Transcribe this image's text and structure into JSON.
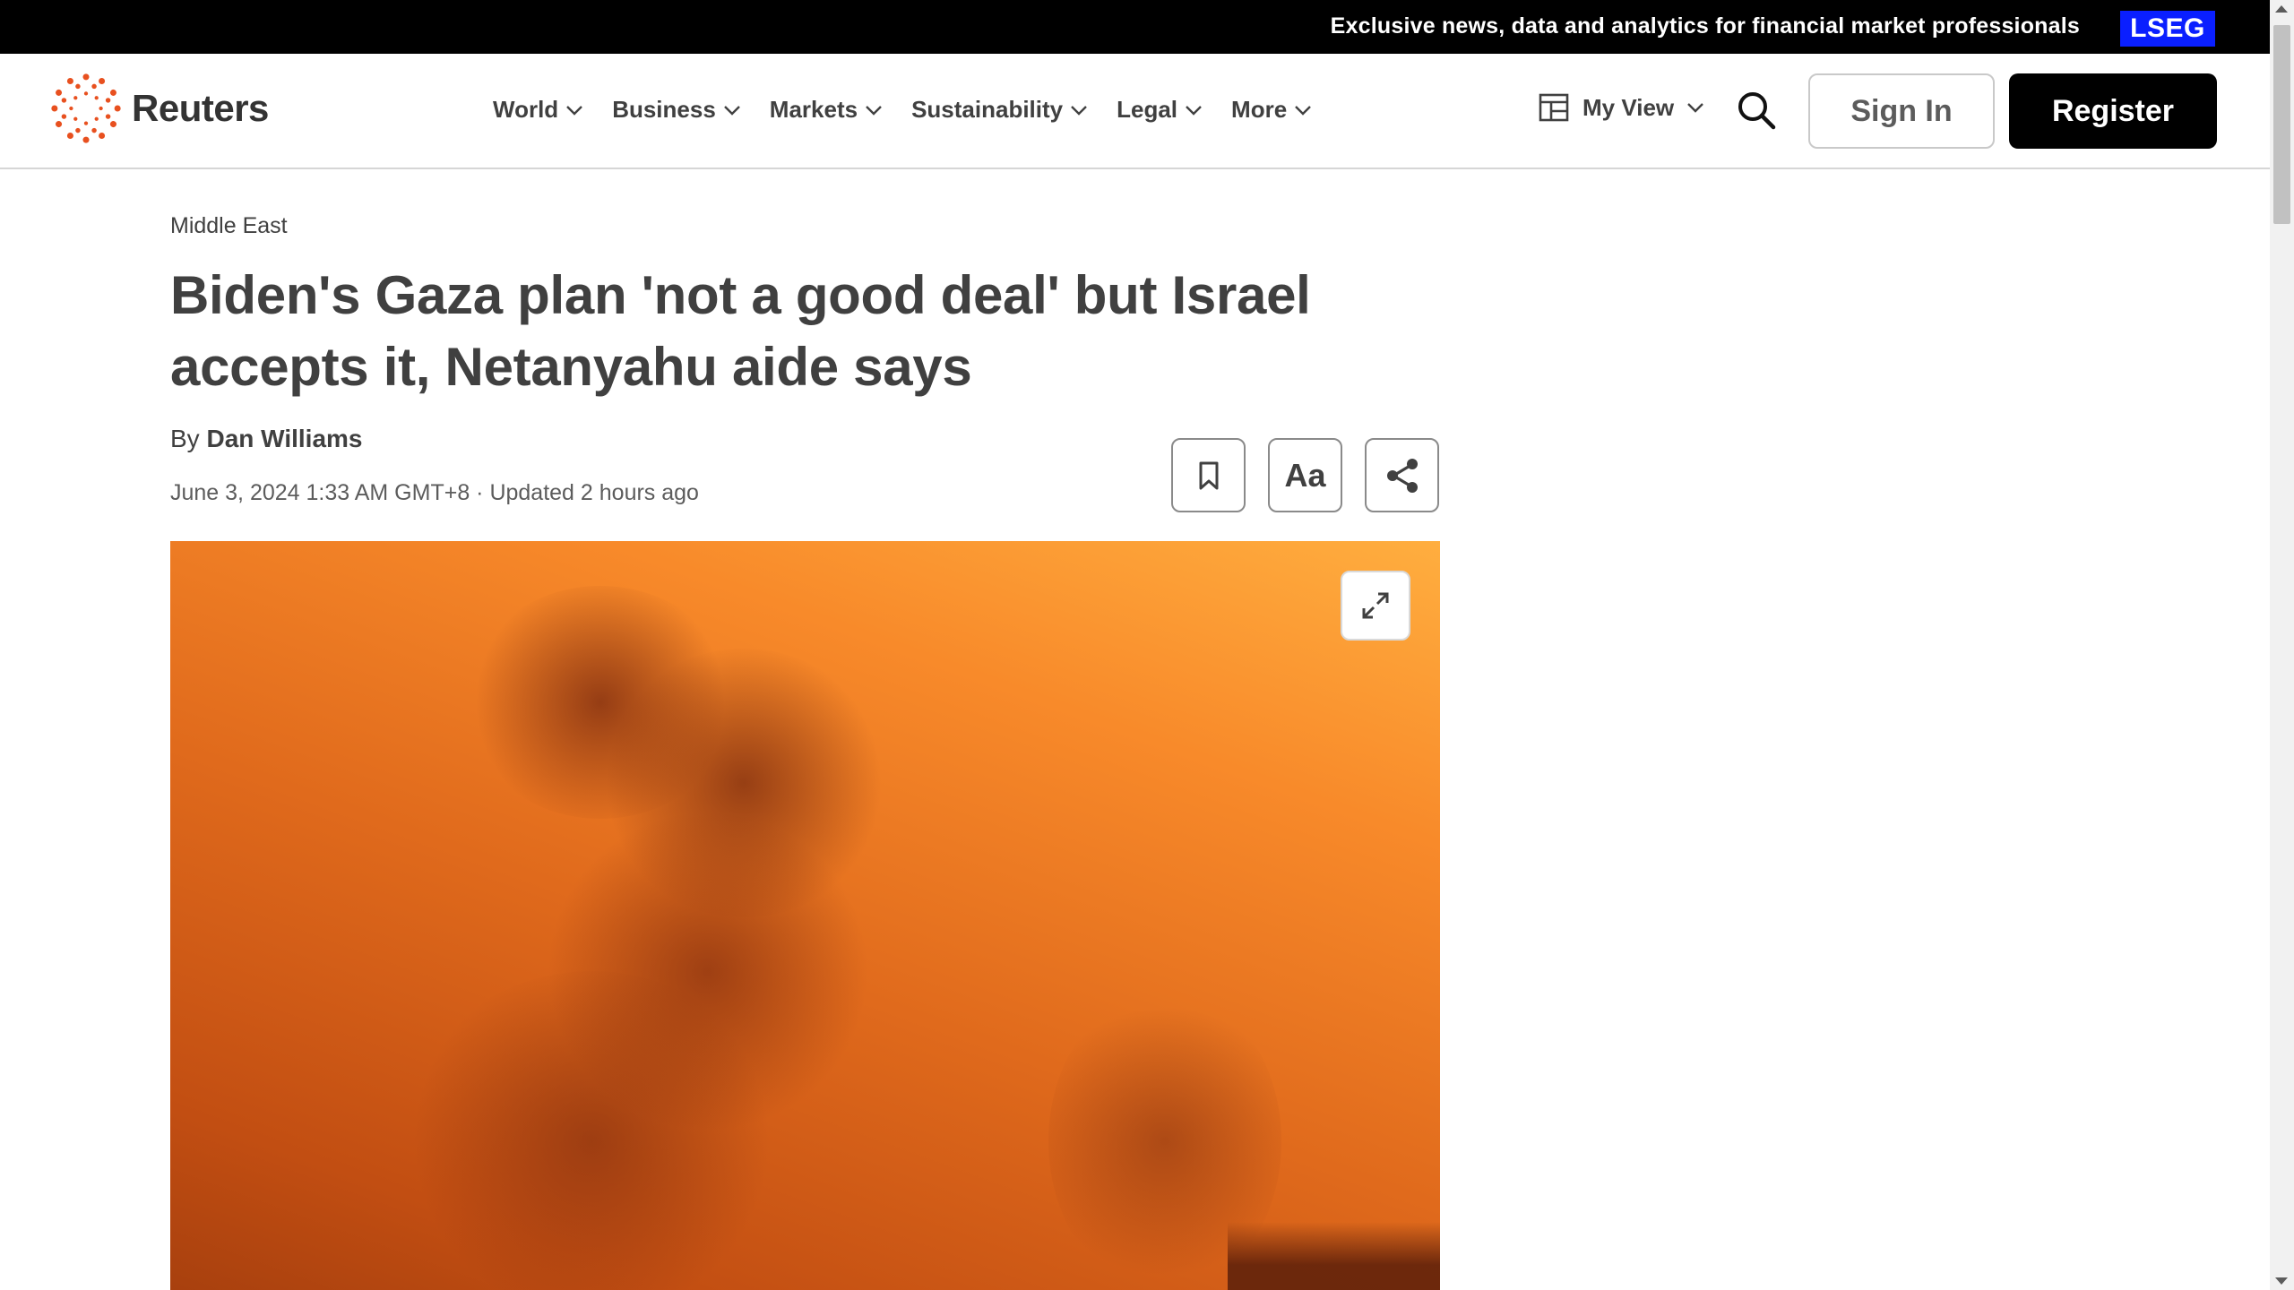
{
  "promo": {
    "text": "Exclusive news, data and analytics for financial market professionals",
    "badge": "LSEG"
  },
  "header": {
    "brand": "Reuters",
    "nav": [
      {
        "label": "World"
      },
      {
        "label": "Business"
      },
      {
        "label": "Markets"
      },
      {
        "label": "Sustainability"
      },
      {
        "label": "Legal"
      },
      {
        "label": "More"
      }
    ],
    "my_view": "My View",
    "sign_in": "Sign In",
    "register": "Register"
  },
  "article": {
    "section": "Middle East",
    "headline": "Biden's Gaza plan 'not a good deal' but Israel accepts it, Netanyahu aide says",
    "byline_prefix": "By",
    "author": "Dan Williams",
    "dateline": "June 3, 2024 1:33 AM GMT+8 · Updated 2 hours ago",
    "font_tool_label": "Aa"
  },
  "colors": {
    "brand_orange": "#e8501f",
    "register_bg": "#000000",
    "lseg_blue": "#0a1fff",
    "text": "#404040"
  },
  "icons": [
    "reuters-logo-icon",
    "chevron-down-icon",
    "my-view-icon",
    "search-icon",
    "bookmark-icon",
    "share-icon",
    "expand-icon"
  ]
}
